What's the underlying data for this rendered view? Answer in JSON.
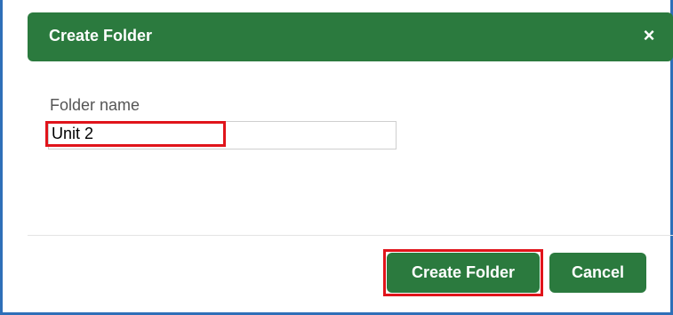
{
  "dialog": {
    "title": "Create Folder",
    "close_icon": "close-icon",
    "close_glyph": "×"
  },
  "form": {
    "folder_name_label": "Folder name",
    "folder_name_value": "Unit 2"
  },
  "footer": {
    "create_label": "Create Folder",
    "cancel_label": "Cancel"
  },
  "colors": {
    "header_bg": "#2b7a3e",
    "button_bg": "#2b7a3e",
    "highlight": "#e0141b",
    "frame_border": "#2f6fb8"
  }
}
